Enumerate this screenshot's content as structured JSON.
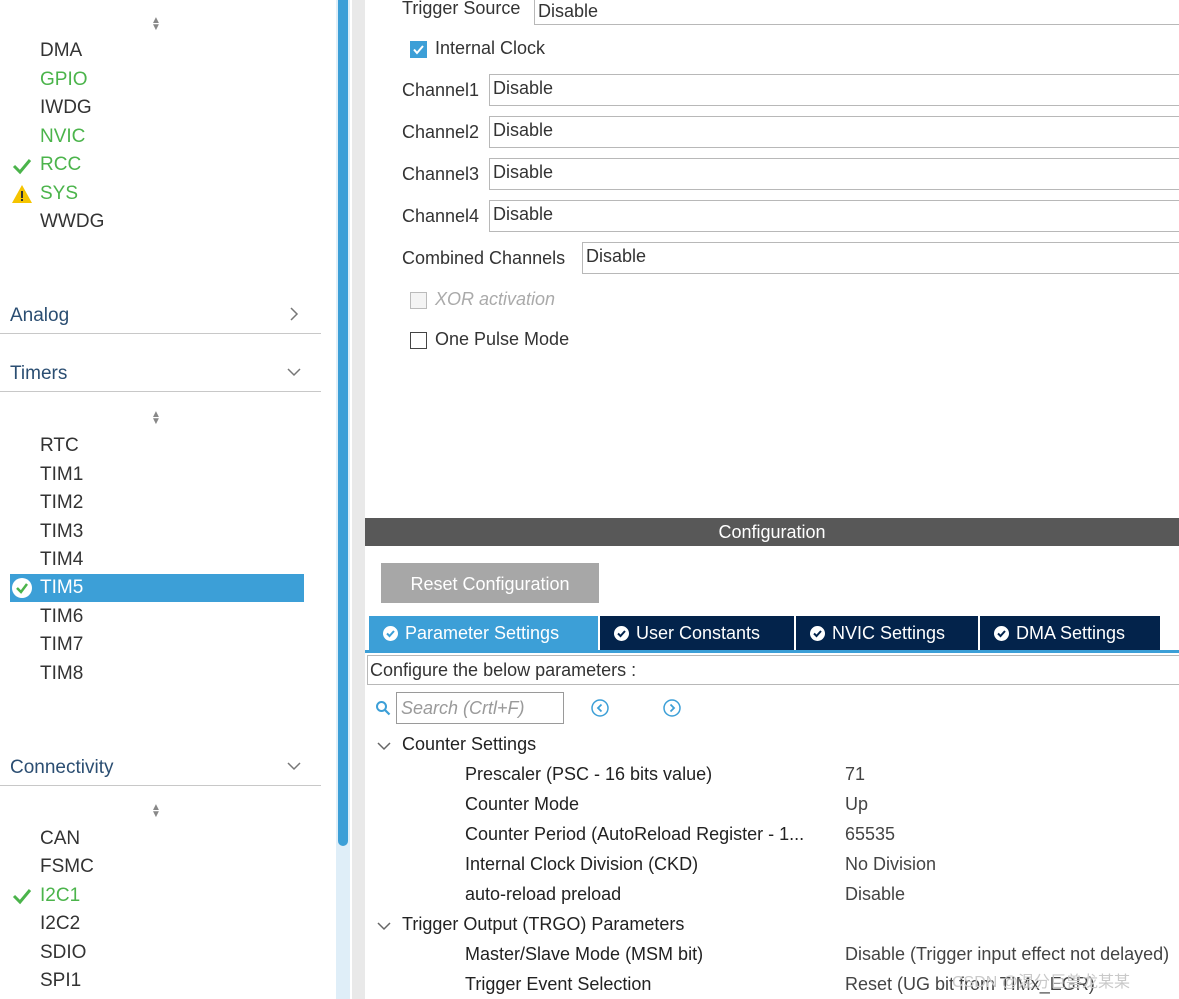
{
  "left_panel": {
    "system_core_items": [
      {
        "label": "DMA",
        "status": "none"
      },
      {
        "label": "GPIO",
        "status": "green"
      },
      {
        "label": "IWDG",
        "status": "none"
      },
      {
        "label": "NVIC",
        "status": "green"
      },
      {
        "label": "RCC",
        "status": "check"
      },
      {
        "label": "SYS",
        "status": "warning"
      },
      {
        "label": "WWDG",
        "status": "none"
      }
    ],
    "categories": {
      "analog": "Analog",
      "timers": "Timers",
      "connectivity": "Connectivity"
    },
    "timer_items": [
      "RTC",
      "TIM1",
      "TIM2",
      "TIM3",
      "TIM4",
      "TIM5",
      "TIM6",
      "TIM7",
      "TIM8"
    ],
    "selected_timer": "TIM5",
    "connectivity_items": [
      {
        "label": "CAN",
        "status": "none"
      },
      {
        "label": "FSMC",
        "status": "none"
      },
      {
        "label": "I2C1",
        "status": "check"
      },
      {
        "label": "I2C2",
        "status": "none"
      },
      {
        "label": "SDIO",
        "status": "none"
      },
      {
        "label": "SPI1",
        "status": "none"
      }
    ]
  },
  "mode": {
    "trigger_source_label": "Trigger Source",
    "trigger_source_value": "Disable",
    "internal_clock_label": "Internal Clock",
    "internal_clock_checked": true,
    "channel1_label": "Channel1",
    "channel1_value": "Disable",
    "channel2_label": "Channel2",
    "channel2_value": "Disable",
    "channel3_label": "Channel3",
    "channel3_value": "Disable",
    "channel4_label": "Channel4",
    "channel4_value": "Disable",
    "combined_label": "Combined Channels",
    "combined_value": "Disable",
    "xor_label": "XOR activation",
    "one_pulse_label": "One Pulse Mode"
  },
  "config": {
    "bar_title": "Configuration",
    "reset_label": "Reset Configuration",
    "tabs": [
      "Parameter Settings",
      "User Constants",
      "NVIC Settings",
      "DMA Settings"
    ],
    "describe_text": "Configure the below parameters :",
    "search_placeholder": "Search (Crtl+F)",
    "groups": [
      {
        "label": "Counter Settings",
        "params": [
          {
            "name": "Prescaler (PSC - 16 bits value)",
            "value": "71"
          },
          {
            "name": "Counter Mode",
            "value": "Up"
          },
          {
            "name": "Counter Period (AutoReload Register - 1...",
            "value": "65535"
          },
          {
            "name": "Internal Clock Division (CKD)",
            "value": "No Division"
          },
          {
            "name": "auto-reload preload",
            "value": "Disable"
          }
        ]
      },
      {
        "label": "Trigger Output (TRGO) Parameters",
        "params": [
          {
            "name": "Master/Slave Mode (MSM bit)",
            "value": "Disable (Trigger input effect not delayed)"
          },
          {
            "name": "Trigger Event Selection",
            "value": "Reset (UG bit from TIMx_EGR)"
          }
        ]
      }
    ]
  },
  "watermark": "CSDN @混分巨兽龙某某",
  "colors": {
    "accent": "#3c9fd7",
    "navy": "#03234b",
    "green": "#4bb44b",
    "warning": "#f5c400"
  }
}
